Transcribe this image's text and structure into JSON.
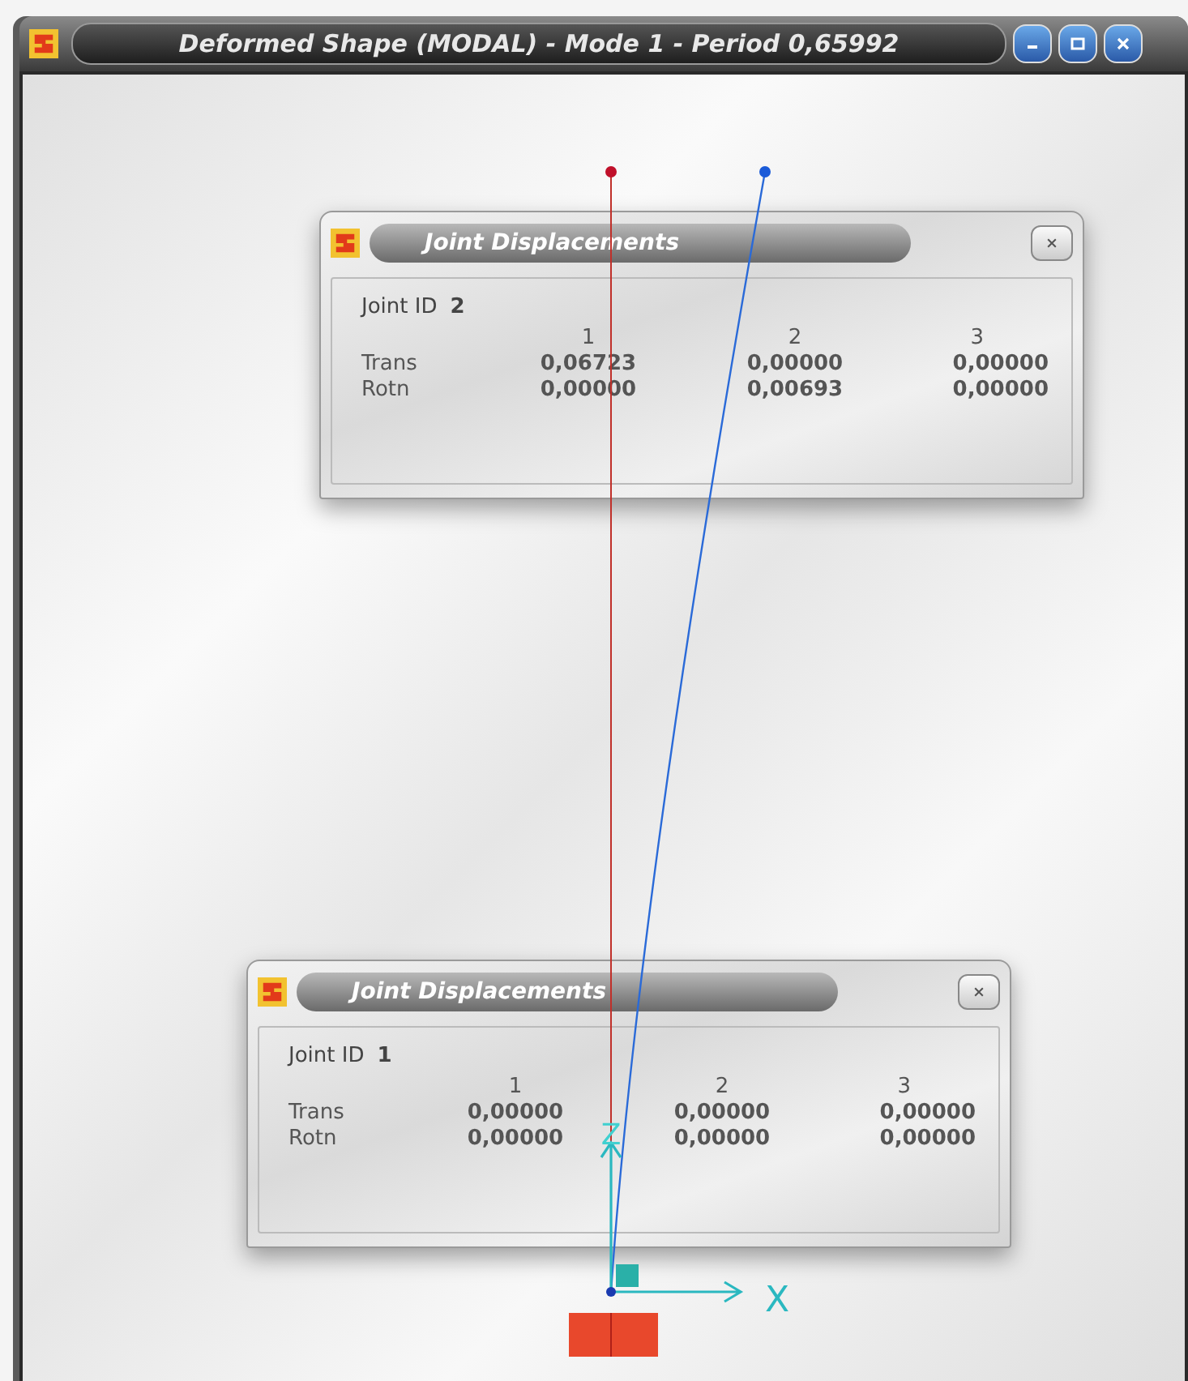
{
  "window": {
    "title": "Deformed Shape (MODAL) - Mode 1 - Period 0,65992"
  },
  "axes": {
    "x_label": "X",
    "z_label": "Z"
  },
  "dialogs": [
    {
      "title": "Joint Displacements",
      "joint_label": "Joint ID",
      "joint_id": "2",
      "columns": [
        "1",
        "2",
        "3"
      ],
      "rows": [
        {
          "label": "Trans",
          "values": [
            "0,06723",
            "0,00000",
            "0,00000"
          ]
        },
        {
          "label": "Rotn",
          "values": [
            "0,00000",
            "0,00693",
            "0,00000"
          ]
        }
      ]
    },
    {
      "title": "Joint Displacements",
      "joint_label": "Joint ID",
      "joint_id": "1",
      "columns": [
        "1",
        "2",
        "3"
      ],
      "rows": [
        {
          "label": "Trans",
          "values": [
            "0,00000",
            "0,00000",
            "0,00000"
          ]
        },
        {
          "label": "Rotn",
          "values": [
            "0,00000",
            "0,00000",
            "0,00000"
          ]
        }
      ]
    }
  ]
}
